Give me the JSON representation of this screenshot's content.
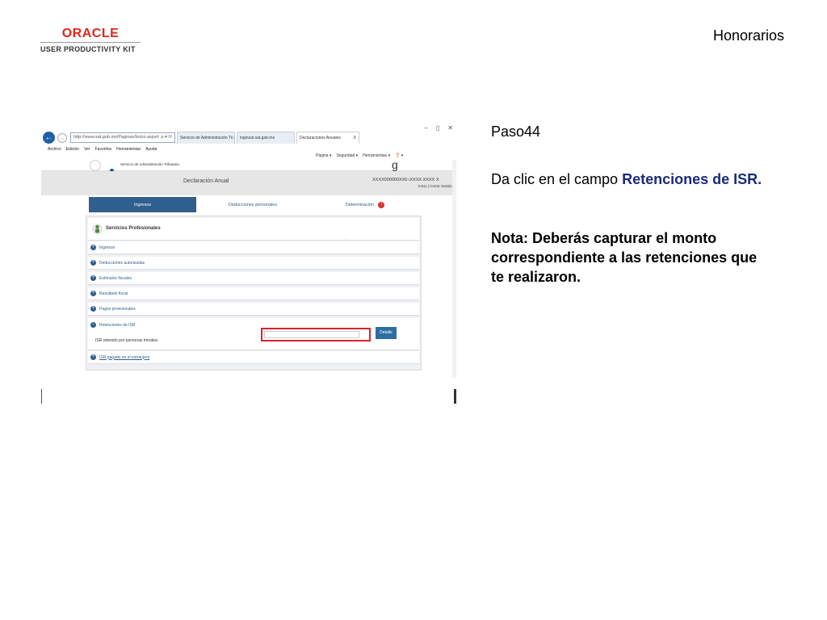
{
  "logo": {
    "brand": "ORACLE",
    "product": "USER PRODUCTIVITY KIT"
  },
  "module_title": "Honorarios",
  "step_label": "Paso44",
  "instruction": {
    "prefix": "Da clic en el campo ",
    "target": "Retenciones de ISR."
  },
  "note": "Nota: Deberás capturar el monto correspondiente a las retenciones que te realizaron.",
  "browser": {
    "window_controls": [
      "–",
      "▯",
      "✕"
    ],
    "url": "http://www.sat.gob.mx/Paginas/Inicio.aspx#",
    "url_icons": "ρ ▾ ⟳",
    "tabs": [
      "Servicio de Administración Tri...",
      "loginsat.sat.gob.mx",
      "Declaraciones Anuales"
    ],
    "tab_close": "X",
    "menu": [
      "Archivo",
      "Edición",
      "Ver",
      "Favoritos",
      "Herramientas",
      "Ayuda"
    ],
    "commands": [
      "Página ▾",
      "Seguridad ▾",
      "Herramientas ▾",
      "❓ ▾"
    ]
  },
  "site": {
    "agency": "Servicio de Administración Tributaria",
    "declaration_title": "Declaración Anual",
    "rfc": "XXXX000000XX0  ıXXXX XXXX X",
    "session_links": "Inicio | Cerrar Sesión",
    "tabs": {
      "ingresos": "Ingresos",
      "deducciones": "Deducciones personales",
      "determinacion": "Determinación",
      "badge": "!"
    },
    "panel_title": "Servicios Profesionales",
    "sections": [
      "Ingresos",
      "Deducciones autorizadas",
      "Estímulos fiscales",
      "Resultado fiscal",
      "Pagos provisionales",
      "Retenciones de ISR",
      "ISR pagado en el extranjero"
    ],
    "retenciones_row_label": "ISR retenido por personas morales",
    "detalle_button": "Detalle"
  },
  "colors": {
    "oracle_red": "#e0261c",
    "sat_blue": "#2e5f8d",
    "highlight_red": "#d9242b",
    "instruction_blue": "#1a2a7a"
  }
}
